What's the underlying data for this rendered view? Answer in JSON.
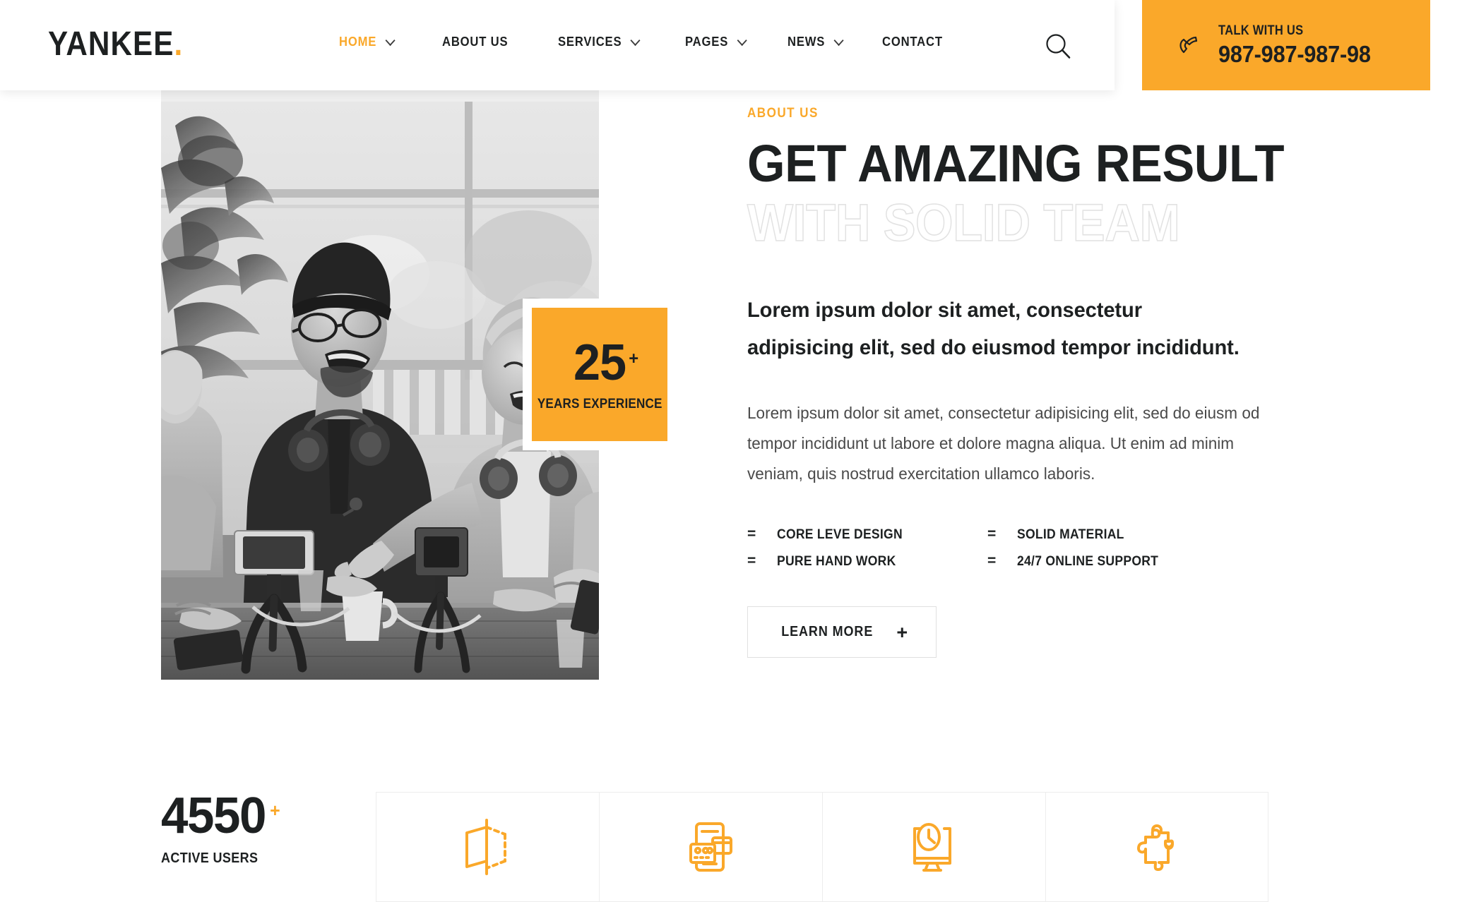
{
  "brand": {
    "name": "YANKEE",
    "dot": ".",
    "accent_color": "#faa82a",
    "dark_color": "#1d2021"
  },
  "header": {
    "nav": [
      {
        "label": "HOME",
        "has_caret": true,
        "active": true
      },
      {
        "label": "ABOUT US",
        "has_caret": false,
        "active": false
      },
      {
        "label": "SERVICES",
        "has_caret": true,
        "active": false
      },
      {
        "label": "PAGES",
        "has_caret": true,
        "active": false
      },
      {
        "label": "NEWS",
        "has_caret": true,
        "active": false
      },
      {
        "label": "CONTACT",
        "has_caret": false,
        "active": false
      }
    ],
    "search_icon": "search-icon",
    "phone": {
      "icon": "phone-handset-icon",
      "label": "TALK WITH US",
      "number": "987-987-987-98"
    }
  },
  "hero": {
    "photo_alt": "three-people-laughing-recording-podcast-grayscale",
    "badge": {
      "number": "25",
      "plus": "+",
      "label": "YEARS EXPERIENCE"
    }
  },
  "about": {
    "eyebrow": "ABOUT US",
    "title_line1": "GET AMAZING RESULT",
    "title_line2": "WITH SOLID TEAM",
    "lead": "Lorem ipsum dolor sit amet, consectetur adipisicing elit, sed do eiusmod tempor incididunt.",
    "body": "Lorem ipsum dolor sit amet, consectetur adipisicing elit, sed do eiusm od tempor incididunt ut labore et dolore magna aliqua. Ut enim ad minim veniam, quis nostrud exercitation ullamco laboris.",
    "features": [
      {
        "mark": "=",
        "label": "CORE LEVE DESIGN"
      },
      {
        "mark": "=",
        "label": "SOLID MATERIAL"
      },
      {
        "mark": "=",
        "label": "PURE HAND WORK"
      },
      {
        "mark": "=",
        "label": "24/7 ONLINE SUPPORT"
      }
    ],
    "cta": {
      "label": "LEARN MORE",
      "plus": "+"
    }
  },
  "stats": {
    "counter": {
      "number": "4550",
      "plus": "+",
      "label": "ACTIVE USERS"
    },
    "cards": [
      {
        "icon": "cube-box-icon"
      },
      {
        "icon": "mobile-payment-icon"
      },
      {
        "icon": "monitor-clock-icon"
      },
      {
        "icon": "puzzle-piece-icon"
      }
    ]
  }
}
